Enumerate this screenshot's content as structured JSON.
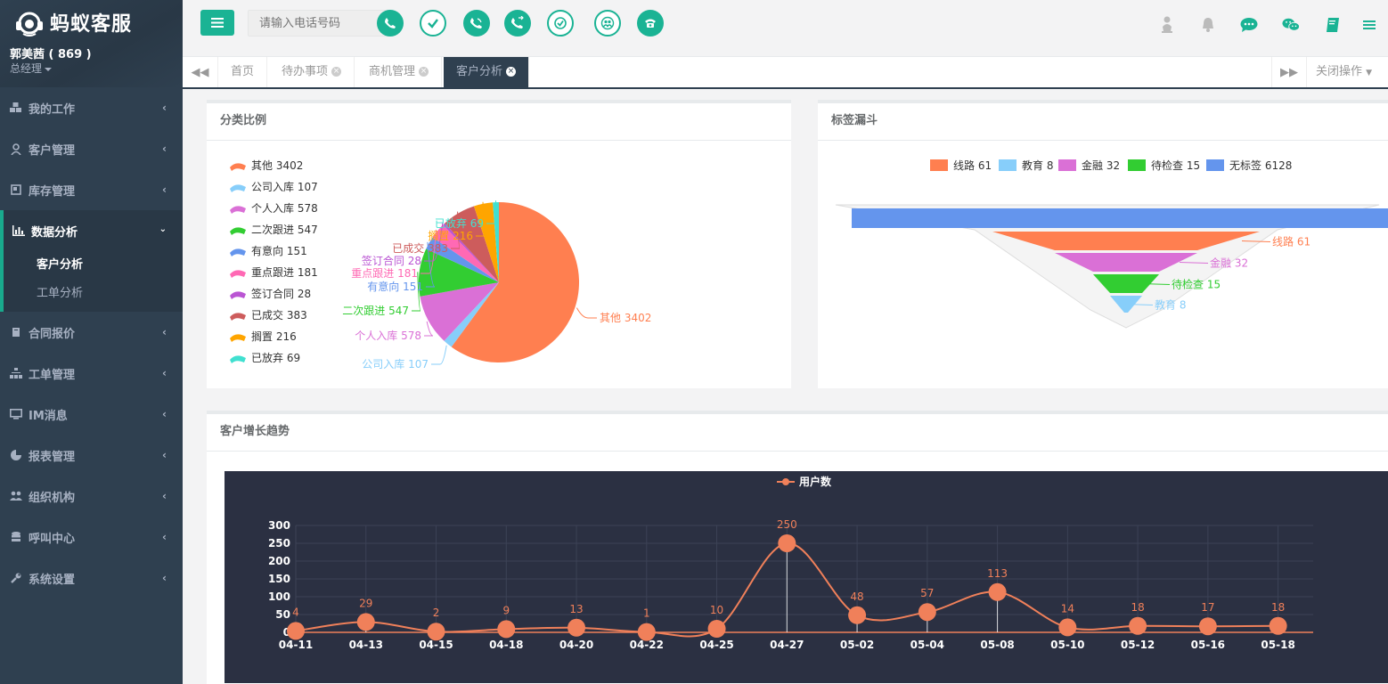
{
  "app": {
    "brand": "蚂蚁客服",
    "user_name": "郭美茜 ( 869 )",
    "user_role": "总经理"
  },
  "sidebar": {
    "items": [
      {
        "label": "我的工作",
        "icon": "cubes-icon"
      },
      {
        "label": "客户管理",
        "icon": "user-icon"
      },
      {
        "label": "库存管理",
        "icon": "box-icon"
      },
      {
        "label": "数据分析",
        "icon": "bar-chart-icon"
      },
      {
        "label": "合同报价",
        "icon": "book-icon"
      },
      {
        "label": "工单管理",
        "icon": "sitemap-icon"
      },
      {
        "label": "IM消息",
        "icon": "monitor-icon"
      },
      {
        "label": "报表管理",
        "icon": "pie-chart-icon"
      },
      {
        "label": "组织机构",
        "icon": "users-icon"
      },
      {
        "label": "呼叫中心",
        "icon": "database-icon"
      },
      {
        "label": "系统设置",
        "icon": "wrench-icon"
      }
    ],
    "sub_items": [
      {
        "label": "客户分析",
        "active": true
      },
      {
        "label": "工单分析",
        "active": false
      }
    ]
  },
  "topbar": {
    "search_placeholder": "请输入电话号码"
  },
  "tabs": {
    "items": [
      {
        "label": "首页",
        "closable": false,
        "active": false
      },
      {
        "label": "待办事项",
        "closable": true,
        "active": false
      },
      {
        "label": "商机管理",
        "closable": true,
        "active": false
      },
      {
        "label": "客户分析",
        "closable": true,
        "active": true
      }
    ],
    "close_ops": "关闭操作"
  },
  "panels": {
    "pie_title": "分类比例",
    "funnel_title": "标签漏斗",
    "trend_title": "客户增长趋势"
  },
  "colors": {
    "primary": "#1ab394",
    "sidebar": "#2f4050",
    "chart_bg": "#2b3042",
    "line": "#f0805a"
  },
  "chart_data": [
    {
      "type": "pie",
      "title": "分类比例",
      "legend": "left",
      "slices": [
        {
          "name": "其他",
          "value": 3402,
          "color": "#ff7f50"
        },
        {
          "name": "公司入库",
          "value": 107,
          "color": "#87cefa"
        },
        {
          "name": "个人入库",
          "value": 578,
          "color": "#da70d6"
        },
        {
          "name": "二次跟进",
          "value": 547,
          "color": "#32cd32"
        },
        {
          "name": "有意向",
          "value": 151,
          "color": "#6495ed"
        },
        {
          "name": "重点跟进",
          "value": 181,
          "color": "#ff69b4"
        },
        {
          "name": "签订合同",
          "value": 28,
          "color": "#ba55d3"
        },
        {
          "name": "已成交",
          "value": 383,
          "color": "#cd5c5c"
        },
        {
          "name": "搁置",
          "value": 216,
          "color": "#ffa500"
        },
        {
          "name": "已放弃",
          "value": 69,
          "color": "#40e0d0"
        }
      ]
    },
    {
      "type": "funnel",
      "title": "标签漏斗",
      "legend": "top",
      "stages": [
        {
          "name": "线路",
          "value": 61,
          "color": "#ff7f50"
        },
        {
          "name": "教育",
          "value": 8,
          "color": "#87cefa"
        },
        {
          "name": "金融",
          "value": 32,
          "color": "#da70d6"
        },
        {
          "name": "待检查",
          "value": 15,
          "color": "#32cd32"
        },
        {
          "name": "无标签",
          "value": 6128,
          "color": "#6495ed"
        }
      ]
    },
    {
      "type": "line",
      "title": "客户增长趋势",
      "series_name": "用户数",
      "x": [
        "04-11",
        "04-13",
        "04-15",
        "04-18",
        "04-20",
        "04-22",
        "04-25",
        "04-27",
        "05-02",
        "05-04",
        "05-08",
        "05-10",
        "05-12",
        "05-16",
        "05-18"
      ],
      "values": [
        4,
        29,
        2,
        9,
        13,
        1,
        10,
        250,
        48,
        57,
        113,
        14,
        18,
        17,
        18
      ],
      "yticks": [
        0,
        50,
        100,
        150,
        200,
        250,
        300
      ],
      "ylim": [
        0,
        300
      ],
      "legend": "top-center",
      "grid": true
    }
  ]
}
